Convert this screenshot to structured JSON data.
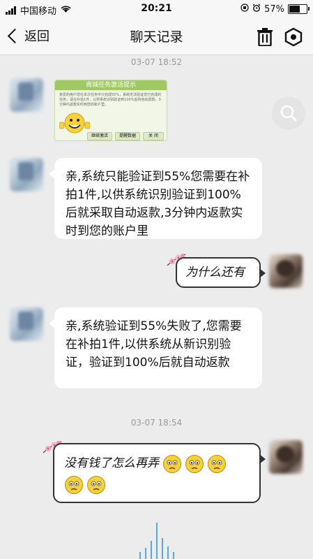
{
  "status_bar": {
    "carrier": "中国移动",
    "time": "20:21",
    "battery": "57%"
  },
  "nav": {
    "back_label": "返回",
    "title": "聊天记录"
  },
  "messages": {
    "timestamp_1": "03-07 18:52",
    "image_notice": {
      "title": "商城任务激活提示",
      "text": "亲爱的用户您在本次任务中只完成55%，系统无法验证您已完成的任务，请在补拍1件，以供系统识别验证到100%后将自动返款，3分钟内返款实时到您的账户里。",
      "button_1": "继续激活",
      "button_2": "提醒数据",
      "button_3": "关 闭"
    },
    "msg_1": "亲,系统只能验证到55%您需要在补拍1件,以供系统识别验证到100%后就采取自动返款,3分钟内返款实时到您的账户里",
    "msg_2": "为什么还有",
    "msg_3": "亲,系统验证到55%失败了,您需要在补拍1件,以供系统从新识别验证，验证到100%后就自动返款",
    "timestamp_2": "03-07 18:54",
    "msg_4": "没有钱了怎么再弄"
  },
  "colors": {
    "background": "#ececec",
    "bubble": "#ffffff",
    "notice_green": "#9fca62",
    "emoji_yellow": "#f6d13a"
  }
}
